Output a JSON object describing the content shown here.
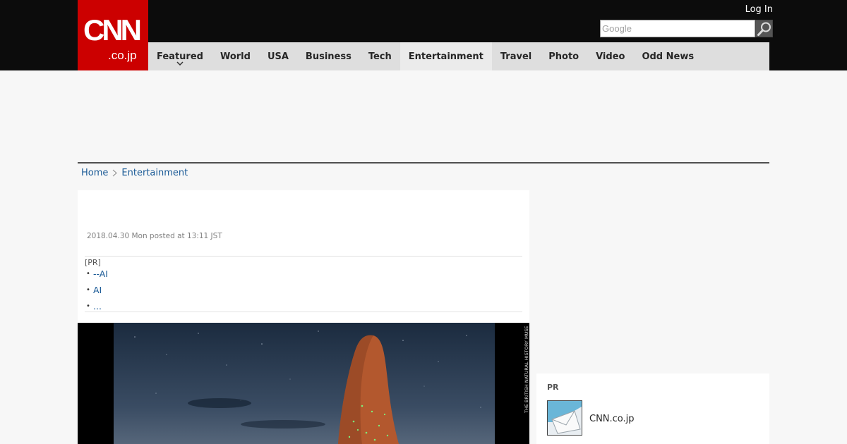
{
  "header": {
    "logo_main": "CNN",
    "logo_sub": ".co.jp",
    "login_label": "Log In",
    "search_placeholder": "Google"
  },
  "nav": {
    "items": [
      {
        "label": "Featured"
      },
      {
        "label": "World"
      },
      {
        "label": "USA"
      },
      {
        "label": "Business"
      },
      {
        "label": "Tech"
      },
      {
        "label": "Entertainment"
      },
      {
        "label": "Travel"
      },
      {
        "label": "Photo"
      },
      {
        "label": "Video"
      },
      {
        "label": "Odd News"
      }
    ],
    "active": "Entertainment"
  },
  "breadcrumb": {
    "home": "Home",
    "current": "Entertainment"
  },
  "article": {
    "posted": "2018.04.30 Mon posted at 13:11 JST",
    "pr_label": "[PR]",
    "pr_links": [
      "--AI",
      "AI",
      "..."
    ],
    "photo_credit": "THE BRITISH NATURAL HISTORY MUSEUM"
  },
  "sidebar": {
    "pr_label": "PR",
    "pr_item_name": "CNN.co.jp"
  },
  "colors": {
    "brand_red": "#cc0000",
    "link_blue": "#1a5a96",
    "topbar_black": "#0c0c0c",
    "nav_gray": "#dedede"
  },
  "icons": {
    "search": "magnifier-icon",
    "breadcrumb_separator": "chevron-right-icon",
    "nav_dropdown": "chevron-down-icon"
  }
}
